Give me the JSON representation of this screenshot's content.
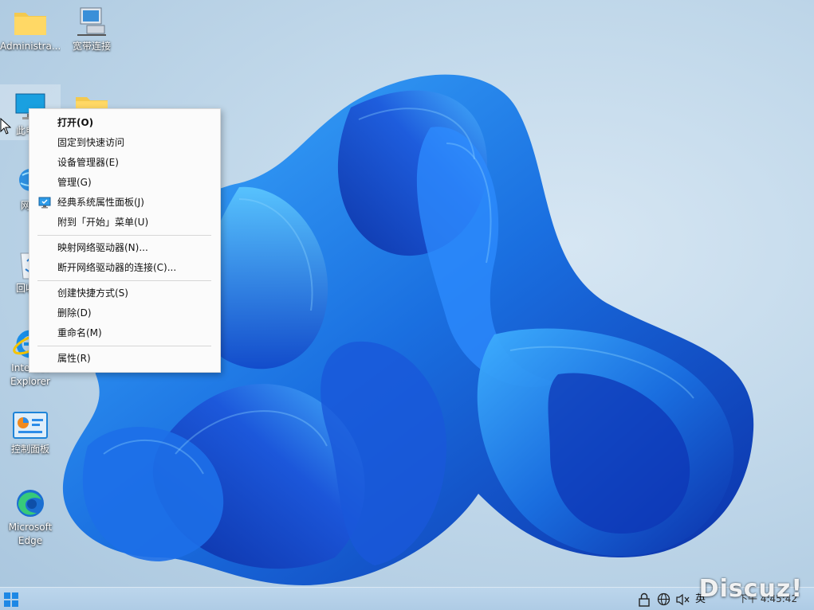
{
  "desktop": {
    "icons": [
      {
        "label": "Administra...",
        "icon": "folder-icon"
      },
      {
        "label": "宽带连接",
        "icon": "network-computer-icon"
      },
      {
        "label": "此电脑",
        "icon": "computer-icon"
      },
      {
        "label": "",
        "icon": "folder-icon"
      },
      {
        "label": "网络",
        "icon": "network-icon"
      },
      {
        "label": "回收站",
        "icon": "recycle-bin-icon"
      },
      {
        "label": "Internet Explorer",
        "icon": "internet-explorer-icon"
      },
      {
        "label": "控制面板",
        "icon": "control-panel-icon"
      },
      {
        "label": "Microsoft Edge",
        "icon": "edge-icon"
      }
    ]
  },
  "context_menu": {
    "items": [
      {
        "label": "打开(O)"
      },
      {
        "label": "固定到快速访问"
      },
      {
        "label": "设备管理器(E)"
      },
      {
        "label": "管理(G)"
      },
      {
        "label": "经典系统属性面板(J)"
      },
      {
        "label": "附到「开始」菜单(U)"
      },
      {
        "label": "映射网络驱动器(N)..."
      },
      {
        "label": "断开网络驱动器的连接(C)..."
      },
      {
        "label": "创建快捷方式(S)"
      },
      {
        "label": "删除(D)"
      },
      {
        "label": "重命名(M)"
      },
      {
        "label": "属性(R)"
      }
    ]
  },
  "taskbar": {
    "tray": {
      "ime_label": "英",
      "clock_text": "下午 4:45:42"
    }
  },
  "watermark": "Discuz!",
  "colors": {
    "accent": "#1a6fe0",
    "menu_bg": "#fbfbfb",
    "taskbar_bg": "#b4cfe8"
  }
}
